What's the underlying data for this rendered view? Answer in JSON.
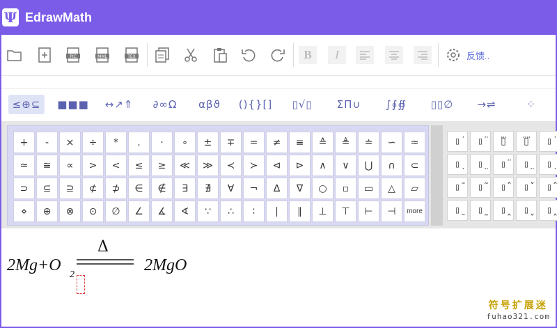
{
  "app": {
    "title": "EdrawMath",
    "logo_glyph": "Ψ"
  },
  "toolbar": {
    "feedback_label": "反馈..",
    "buttons": [
      {
        "name": "open-icon"
      },
      {
        "name": "new-icon"
      },
      {
        "name": "export-pic-icon"
      },
      {
        "name": "export-mml-icon"
      },
      {
        "name": "export-tex-icon"
      },
      {
        "name": "copy-icon"
      },
      {
        "name": "cut-icon"
      },
      {
        "name": "paste-icon"
      },
      {
        "name": "undo-icon"
      },
      {
        "name": "redo-icon"
      },
      {
        "name": "bold-icon"
      },
      {
        "name": "italic-icon"
      },
      {
        "name": "align-left-icon"
      },
      {
        "name": "align-center-icon"
      },
      {
        "name": "align-right-icon"
      },
      {
        "name": "settings-icon"
      }
    ],
    "tags": {
      "pic": "PIC",
      "mml": "MML",
      "tex": "TEX",
      "bold": "B",
      "italic": "I"
    }
  },
  "categories": [
    {
      "label": "≤⊕⊆"
    },
    {
      "label": "■■■"
    },
    {
      "label": "↔↗⇑"
    },
    {
      "label": "∂∞Ω"
    },
    {
      "label": "αβϑ"
    },
    {
      "label": "(){}[]"
    },
    {
      "label": "▯√▯"
    },
    {
      "label": "ΣΠ∪"
    },
    {
      "label": "∫∮∯"
    },
    {
      "label": "▯▯∅"
    },
    {
      "label": "→⇌"
    },
    {
      "label": "⁘"
    }
  ],
  "symbols": [
    "+",
    "-",
    "×",
    "÷",
    "*",
    ".",
    "·",
    "∘",
    "±",
    "∓",
    "=",
    "≠",
    "≡",
    "≙",
    "≜",
    "≐",
    "∽",
    "≈",
    "≃",
    "≅",
    "∝",
    ">",
    "<",
    "≤",
    "≥",
    "≪",
    "≫",
    "≺",
    "≻",
    "⊲",
    "⊳",
    "∧",
    "∨",
    "⋃",
    "∩",
    "⊂",
    "⊃",
    "⊆",
    "⊇",
    "⊄",
    "⊅",
    "∈",
    "∉",
    "∃",
    "∄",
    "∀",
    "¬",
    "∆",
    "∇",
    "○",
    "▫",
    "▭",
    "△",
    "▱",
    "⋄",
    "⊕",
    "⊗",
    "⊙",
    "∅",
    "∠",
    "∡",
    "∢",
    "∵",
    "∴",
    "∶",
    "∣",
    "∥",
    "⊥",
    "⊤",
    "⊢",
    "⊣",
    "more"
  ],
  "accents": [
    "▯̇",
    "▯̈",
    "▯⃛",
    "▯⃜",
    "▯̇",
    "▯̣",
    "▯̤",
    "▯̈",
    "▯̤",
    "▯̣",
    "▯̄",
    "▯̃",
    "▯̂",
    "▯̌",
    "▯̂",
    "▯̱",
    "▯̰",
    "▯̭",
    "▯̬",
    "▯̭"
  ],
  "equation": {
    "left": "2Mg+O",
    "subscript": "2",
    "condition": "Δ",
    "right": "2MgO"
  },
  "watermark": {
    "cn": "符号扩展迷",
    "en": "fuhao321.com"
  }
}
